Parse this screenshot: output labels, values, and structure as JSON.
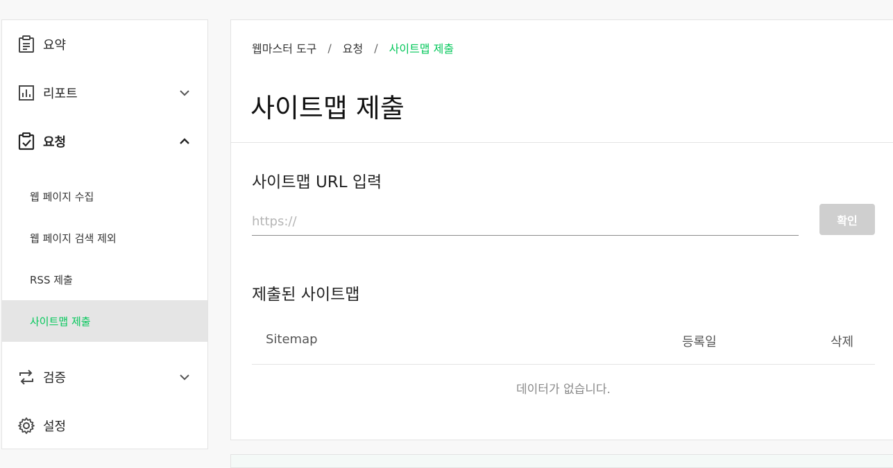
{
  "sidebar": {
    "summary": "요약",
    "report": "리포트",
    "request": "요청",
    "sub_items": [
      "웹 페이지 수집",
      "웹 페이지 검색 제외",
      "RSS 제출",
      "사이트맵 제출"
    ],
    "verify": "검증",
    "settings": "설정"
  },
  "breadcrumb": {
    "root": "웹마스터 도구",
    "sep": "/",
    "parent": "요청",
    "current": "사이트맵 제출"
  },
  "page_title": "사이트맵 제출",
  "url_section": {
    "title": "사이트맵 URL 입력",
    "placeholder": "https://",
    "confirm_label": "확인"
  },
  "submitted": {
    "title": "제출된 사이트맵",
    "columns": [
      "Sitemap",
      "등록일",
      "삭제"
    ],
    "empty_message": "데이터가 없습니다."
  },
  "colors": {
    "accent": "#03c75a",
    "button_disabled": "#cfcfcf"
  }
}
